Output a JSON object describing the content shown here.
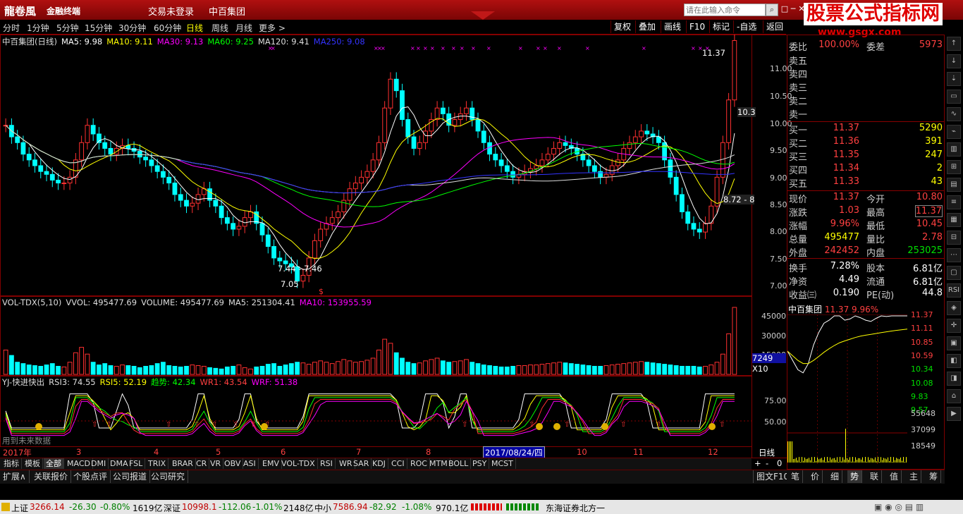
{
  "titlebar": {
    "logo": "龍卷風",
    "sub": "金融终端",
    "login": "交易未登录",
    "stock": "中百集团",
    "placeholder": "请在此输入命令",
    "win_btns": [
      "□",
      "─",
      "✕"
    ]
  },
  "watermark": {
    "line1": "股票公式指标网",
    "line2": "www.gsgx.com"
  },
  "periods": [
    "分时",
    "1分钟",
    "5分钟",
    "15分钟",
    "30分钟",
    "60分钟",
    "日线",
    "周线",
    "月线",
    "更多 >"
  ],
  "selected_period": "日线",
  "toolbar_right": [
    "复权",
    "叠加",
    "画线",
    "F10",
    "标记",
    "-自选",
    "返回"
  ],
  "main_legend": [
    {
      "text": "中百集团(日线)",
      "color": "#dddddd"
    },
    {
      "text": "MA5: 9.98",
      "color": "#ffffff"
    },
    {
      "text": "MA10: 9.11",
      "color": "#ffff00"
    },
    {
      "text": "MA30: 9.13",
      "color": "#ff00ff"
    },
    {
      "text": "MA60: 9.25",
      "color": "#00ff00"
    },
    {
      "text": "MA120: 9.41",
      "color": "#dddddd"
    },
    {
      "text": "MA250: 9.08",
      "color": "#3333ff"
    }
  ],
  "main_axis": [
    "11.00",
    "10.50",
    "10.00",
    "9.50",
    "9.00",
    "8.50",
    "8.00",
    "7.50",
    "7.00"
  ],
  "main_annot": {
    "high": "11.37",
    "low": "7.05",
    "range": "7.44 - 7.46",
    "mark1": "10.3",
    "mark2": "8.72 - 8"
  },
  "vol_legend": [
    {
      "text": "VOL-TDX(5,10)",
      "color": "#dddddd"
    },
    {
      "text": "VVOL: 495477.69",
      "color": "#dddddd"
    },
    {
      "text": "VOLUME: 495477.69",
      "color": "#dddddd"
    },
    {
      "text": "MA5: 251304.41",
      "color": "#dddddd"
    },
    {
      "text": "MA10: 153955.59",
      "color": "#ff00ff"
    }
  ],
  "vol_axis": [
    "45000",
    "30000",
    "15000"
  ],
  "vol_box": {
    "value": "7249",
    "unit": "X10"
  },
  "ind_legend": [
    {
      "text": "YJ-快进快出",
      "color": "#dddddd"
    },
    {
      "text": "RSI3: 74.55",
      "color": "#dddddd"
    },
    {
      "text": "RSI5: 52.19",
      "color": "#ffff00"
    },
    {
      "text": "趋势: 42.34",
      "color": "#00ff00"
    },
    {
      "text": "WR1: 43.54",
      "color": "#ff4040"
    },
    {
      "text": "WRF: 51.38",
      "color": "#ff00ff"
    }
  ],
  "ind_axis": [
    "75.00",
    "50.00"
  ],
  "ind_note": "用到未来数据",
  "date_axis": {
    "labels": [
      "2017年",
      "3",
      "4",
      "5",
      "6",
      "7",
      "8",
      "9",
      "10",
      "11",
      "12"
    ],
    "highlight": "2017/08/24/四",
    "right": "日线"
  },
  "indicators": [
    "指标",
    "模板",
    "全部",
    "MACD",
    "DMI",
    "DMA",
    "FSL",
    "TRIX",
    "BRAR",
    "CR",
    "VR",
    "OBV",
    "ASI",
    "EMV",
    "VOL-TDX",
    "RSI",
    "WR",
    "SAR",
    "KDJ",
    "CCI",
    "ROC",
    "MTM",
    "BOLL",
    "PSY",
    "MCST"
  ],
  "ind_selected": "全部",
  "zoom": [
    "+",
    "-",
    "0"
  ],
  "bottom_tabs": [
    "扩展∧",
    "关联报价",
    "个股点评",
    "公司报道",
    "公司研究"
  ],
  "right_tabs": [
    "笔",
    "价",
    "细",
    "势",
    "联",
    "值",
    "主",
    "筹"
  ],
  "right_tab_selected": "势",
  "f10_tab": "图文F10",
  "order_book": {
    "weibi": {
      "label": "委比",
      "value": "100.00%",
      "label2": "委差",
      "value2": "5973"
    },
    "sells": [
      "卖五",
      "卖四",
      "卖三",
      "卖二",
      "卖一"
    ],
    "buys": [
      {
        "label": "买一",
        "price": "11.37",
        "vol": "5290"
      },
      {
        "label": "买二",
        "price": "11.36",
        "vol": "391"
      },
      {
        "label": "买三",
        "price": "11.35",
        "vol": "247"
      },
      {
        "label": "买四",
        "price": "11.34",
        "vol": "2"
      },
      {
        "label": "买五",
        "price": "11.33",
        "vol": "43"
      }
    ]
  },
  "stats": [
    {
      "k": "现价",
      "v": "11.37",
      "vc": "r",
      "k2": "今开",
      "v2": "10.80",
      "v2c": "r"
    },
    {
      "k": "涨跌",
      "v": "1.03",
      "vc": "r",
      "k2": "最高",
      "v2": "11.37",
      "v2c": "r"
    },
    {
      "k": "涨幅",
      "v": "9.96%",
      "vc": "r",
      "k2": "最低",
      "v2": "10.45",
      "v2c": "r"
    },
    {
      "k": "总量",
      "v": "495477",
      "vc": "y",
      "k2": "量比",
      "v2": "2.78",
      "v2c": "r"
    },
    {
      "k": "外盘",
      "v": "242452",
      "vc": "r",
      "k2": "内盘",
      "v2": "253025",
      "v2c": "g"
    },
    {
      "k": "换手",
      "v": "7.28%",
      "vc": "w",
      "k2": "股本",
      "v2": "6.81亿",
      "v2c": "w"
    },
    {
      "k": "净资",
      "v": "4.49",
      "vc": "w",
      "k2": "流通",
      "v2": "6.81亿",
      "v2c": "w"
    },
    {
      "k": "收益㈢",
      "v": "0.190",
      "vc": "w",
      "k2": "PE(动)",
      "v2": "44.8",
      "v2c": "w"
    }
  ],
  "mini": {
    "title": "中百集团",
    "price": "11.37",
    "pct": "9.96%",
    "price_axis": [
      "11.37",
      "11.11",
      "10.85",
      "10.59",
      "10.34",
      "10.08",
      "9.83",
      "9.57"
    ],
    "vol_axis": [
      "55648",
      "37099",
      "18549"
    ]
  },
  "status": {
    "sh_label": "上证",
    "sh_val": "3266.14",
    "sh_chg": "-26.30",
    "sh_pct": "-0.80%",
    "sh_amt": "1619亿",
    "sz_label": "深证",
    "sz_val": "10998.1",
    "sz_chg": "-112.06",
    "sz_pct": "-1.01%",
    "sz_amt": "2148亿",
    "zx_label": "中小",
    "zx_val": "7586.94",
    "zx_chg": "-82.92",
    "zx_pct": "-1.08%",
    "zx_amt": "970.1亿",
    "broker": "东海证券北方一"
  },
  "chart_data": {
    "type": "candlestick",
    "title": "中百集团(日线)",
    "x_range": [
      "2017-01",
      "2017-12"
    ],
    "ylim": [
      7.0,
      11.4
    ],
    "closes": [
      9.9,
      9.7,
      9.6,
      9.4,
      9.3,
      9.2,
      9.1,
      9.05,
      8.95,
      8.9,
      8.9,
      9.0,
      9.3,
      9.6,
      9.9,
      9.75,
      9.6,
      9.5,
      9.4,
      9.5,
      9.55,
      9.5,
      9.45,
      9.35,
      9.3,
      9.2,
      9.1,
      9.0,
      8.9,
      8.7,
      8.6,
      8.5,
      8.55,
      8.7,
      8.8,
      8.6,
      8.5,
      8.3,
      8.2,
      8.1,
      8.15,
      8.3,
      8.4,
      8.2,
      8.0,
      7.8,
      7.6,
      7.55,
      7.5,
      7.45,
      7.2,
      7.3,
      7.6,
      7.9,
      8.1,
      8.2,
      8.3,
      8.4,
      8.6,
      8.8,
      8.9,
      9.0,
      9.1,
      9.3,
      9.6,
      10.2,
      10.7,
      10.5,
      10.0,
      9.7,
      9.5,
      9.6,
      9.8,
      10.0,
      10.2,
      10.1,
      9.9,
      10.0,
      10.1,
      10.2,
      10.0,
      9.8,
      9.6,
      9.4,
      9.3,
      9.2,
      9.1,
      9.0,
      9.05,
      9.1,
      9.15,
      9.2,
      9.3,
      9.4,
      9.5,
      9.6,
      9.55,
      9.5,
      9.4,
      9.3,
      9.2,
      9.1,
      9.0,
      9.05,
      9.2,
      9.3,
      9.5,
      9.6,
      9.7,
      9.8,
      9.75,
      9.7,
      9.6,
      9.3,
      9.0,
      8.7,
      8.4,
      8.2,
      8.1,
      8.05,
      8.2,
      8.5,
      9.0,
      9.6,
      10.34,
      11.37
    ],
    "ma_series": [
      "MA5",
      "MA10",
      "MA30",
      "MA60",
      "MA120",
      "MA250"
    ],
    "volume": [
      18000,
      14000,
      9000,
      8000,
      7000,
      6500,
      6000,
      7000,
      8000,
      6000,
      5500,
      9000,
      16000,
      20000,
      15000,
      9000,
      7000,
      8000,
      6500,
      6000,
      7000,
      6500,
      6000,
      5000,
      6000,
      6500,
      8000,
      9000,
      6500,
      6000,
      5500,
      6000,
      7000,
      6500,
      6000,
      5000,
      4500,
      4000,
      5500,
      6000,
      7000,
      5000,
      4000,
      5500,
      6000,
      7500,
      8000,
      6000,
      7000,
      8000,
      9000,
      8500,
      7500,
      9000,
      10000,
      9000,
      8000,
      9500,
      11000,
      10000,
      9000,
      9500,
      10500,
      12000,
      18000,
      26000,
      23000,
      16000,
      12000,
      9000,
      8000,
      8500,
      10000,
      11000,
      12000,
      10000,
      9000,
      9500,
      10000,
      11000,
      9000,
      8000,
      7000,
      6500,
      6000,
      5500,
      5500,
      6000,
      6500,
      6500,
      7000,
      7000,
      7500,
      8000,
      8500,
      9000,
      8500,
      8000,
      7500,
      7000,
      6500,
      6000,
      6000,
      6500,
      7000,
      7500,
      8000,
      8500,
      9000,
      9500,
      9000,
      8500,
      8000,
      7500,
      7000,
      6500,
      6000,
      6000,
      6000,
      5500,
      6000,
      7000,
      9000,
      15000,
      30000,
      49500
    ],
    "minute_prices": [
      10.8,
      10.65,
      10.5,
      10.45,
      10.6,
      10.9,
      11.1,
      11.25,
      11.3,
      11.37,
      11.37,
      11.3,
      11.32,
      11.37,
      11.34,
      11.3,
      11.28,
      11.33,
      11.37,
      11.36,
      11.37,
      11.37,
      11.37,
      11.37
    ]
  }
}
